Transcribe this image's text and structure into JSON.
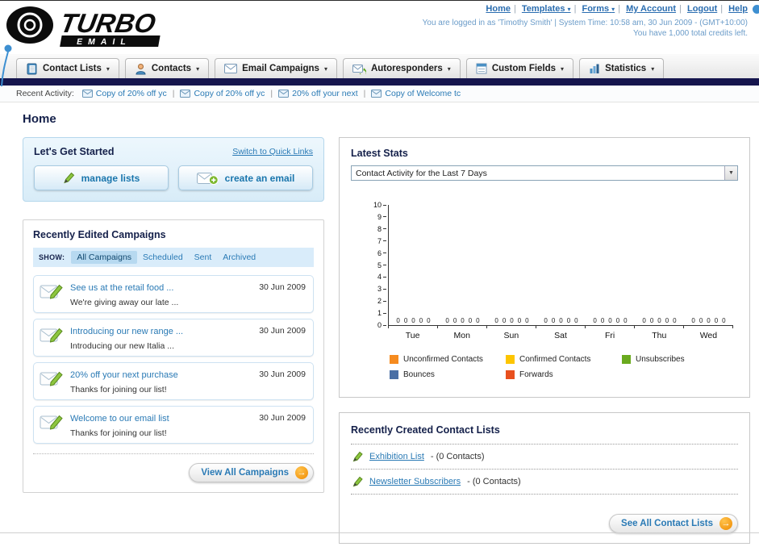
{
  "header": {
    "logo": {
      "title": "TURBO",
      "subtitle": "EMAIL"
    },
    "links": [
      {
        "label": "Home"
      },
      {
        "label": "Templates"
      },
      {
        "label": "Forms"
      },
      {
        "label": "My Account"
      },
      {
        "label": "Logout"
      },
      {
        "label": "Help"
      }
    ],
    "login_info": "You are logged in as 'Timothy Smith' | System Time: 10:58 am, 30 Jun 2009 - (GMT+10:00)",
    "credits_info": "You have 1,000 total credits left."
  },
  "nav": {
    "tabs": [
      {
        "label": "Contact Lists"
      },
      {
        "label": "Contacts"
      },
      {
        "label": "Email Campaigns"
      },
      {
        "label": "Autoresponders"
      },
      {
        "label": "Custom Fields"
      },
      {
        "label": "Statistics"
      }
    ]
  },
  "activity": {
    "label": "Recent Activity:",
    "items": [
      {
        "label": "Copy of 20% off yc"
      },
      {
        "label": "Copy of 20% off yc"
      },
      {
        "label": "20% off your next"
      },
      {
        "label": "Copy of Welcome tc"
      }
    ]
  },
  "page": {
    "title": "Home"
  },
  "get_started": {
    "title": "Let's Get Started",
    "switch_link": "Switch to Quick Links",
    "manage_lists": "manage lists",
    "create_email": "create an email"
  },
  "campaigns": {
    "title": "Recently Edited Campaigns",
    "show_label": "SHOW:",
    "tabs": [
      {
        "label": "All Campaigns",
        "active": true
      },
      {
        "label": "Scheduled",
        "active": false
      },
      {
        "label": "Sent",
        "active": false
      },
      {
        "label": "Archived",
        "active": false
      }
    ],
    "items": [
      {
        "title": "See us at the retail food ...",
        "subtitle": "We're giving away our late ...",
        "date": "30 Jun 2009"
      },
      {
        "title": "Introducing our new range ...",
        "subtitle": "Introducing our new Italia ...",
        "date": "30 Jun 2009"
      },
      {
        "title": "20% off your next purchase",
        "subtitle": "Thanks for joining our list!",
        "date": "30 Jun 2009"
      },
      {
        "title": "Welcome to our email list",
        "subtitle": "Thanks for joining our list!",
        "date": "30 Jun 2009"
      }
    ],
    "view_all_label": "View All Campaigns"
  },
  "stats": {
    "title": "Latest Stats",
    "filter_value": "Contact Activity for the Last 7 Days",
    "chart_data": {
      "type": "bar",
      "title": "Contact Activity for the Last 7 Days",
      "categories": [
        "Tue",
        "Mon",
        "Sun",
        "Sat",
        "Fri",
        "Thu",
        "Wed"
      ],
      "series": [
        {
          "name": "Unconfirmed Contacts",
          "color": "#f68b1f",
          "values": [
            0,
            0,
            0,
            0,
            0,
            0,
            0
          ]
        },
        {
          "name": "Confirmed Contacts",
          "color": "#fdc500",
          "values": [
            0,
            0,
            0,
            0,
            0,
            0,
            0
          ]
        },
        {
          "name": "Unsubscribes",
          "color": "#6aaa1e",
          "values": [
            0,
            0,
            0,
            0,
            0,
            0,
            0
          ]
        },
        {
          "name": "Bounces",
          "color": "#4a6fa5",
          "values": [
            0,
            0,
            0,
            0,
            0,
            0,
            0
          ]
        },
        {
          "name": "Forwards",
          "color": "#e8501e",
          "values": [
            0,
            0,
            0,
            0,
            0,
            0,
            0
          ]
        }
      ],
      "ylim": [
        0,
        10
      ],
      "grid": false,
      "legend_position": "bottom"
    }
  },
  "contact_lists": {
    "title": "Recently Created Contact Lists",
    "items": [
      {
        "name": "Exhibition List",
        "detail": "- (0 Contacts)"
      },
      {
        "name": "Newsletter Subscribers",
        "detail": "- (0 Contacts)"
      }
    ],
    "see_all_label": "See All Contact Lists"
  }
}
